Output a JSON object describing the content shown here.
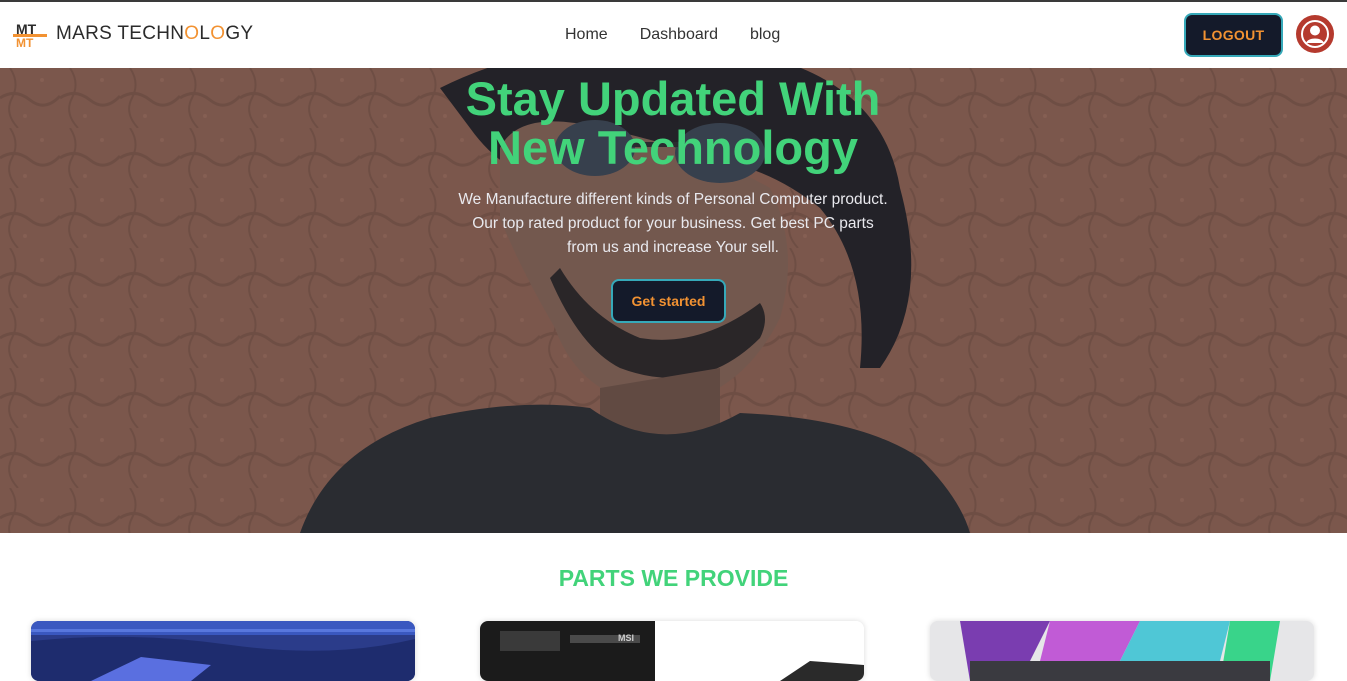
{
  "brand": {
    "logo_letters": "MT",
    "name_part1": "MARS TECHN",
    "name_o1": "O",
    "name_part2": "L",
    "name_o2": "O",
    "name_part3": "GY"
  },
  "nav": {
    "links": [
      {
        "label": "Home"
      },
      {
        "label": "Dashboard"
      },
      {
        "label": "blog"
      }
    ]
  },
  "auth": {
    "logout_label": "LOGOUT",
    "avatar_icon": "user-icon"
  },
  "hero": {
    "title_line1": "Stay Updated With",
    "title_line2": "New Technology",
    "desc_line1": "We Manufacture different kinds of Personal Computer product.",
    "desc_line2": "Our top rated product for your business. Get best PC parts",
    "desc_line3": "from us and increase Your sell.",
    "cta_label": "Get started"
  },
  "parts": {
    "title": "PARTS WE PROVIDE"
  },
  "colors": {
    "accent_green": "#42d37a",
    "accent_orange": "#f29232",
    "button_bg": "#141a2a",
    "button_border": "#36a9b9"
  }
}
